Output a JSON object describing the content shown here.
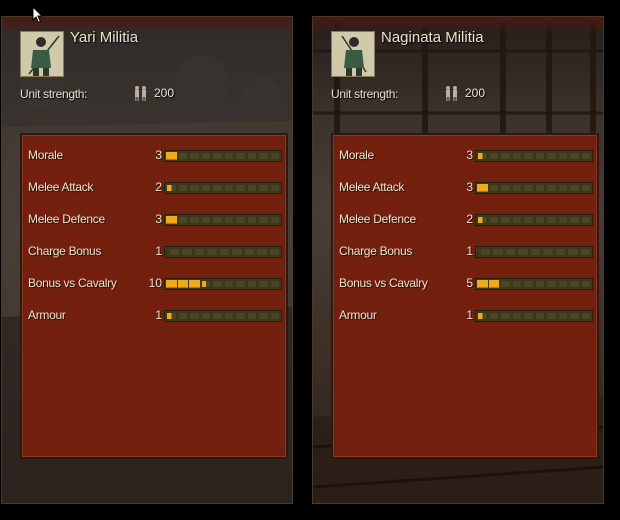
{
  "cursor": "arrow-cursor",
  "colors": {
    "panel": "#73200f",
    "bar_on": "#f3a91c",
    "bar_off": "#4a4626"
  },
  "units": [
    {
      "name": "Yari Militia",
      "strength_label": "Unit strength:",
      "strength_value": "200",
      "stats": [
        {
          "label": "Morale",
          "value": "3",
          "fill": 1
        },
        {
          "label": "Melee Attack",
          "value": "2",
          "fill": 0.5
        },
        {
          "label": "Melee Defence",
          "value": "3",
          "fill": 1
        },
        {
          "label": "Charge Bonus",
          "value": "1",
          "fill": 0.2
        },
        {
          "label": "Bonus vs Cavalry",
          "value": "10",
          "fill": 3.5
        },
        {
          "label": "Armour",
          "value": "1",
          "fill": 0.5
        }
      ]
    },
    {
      "name": "Naginata Militia",
      "strength_label": "Unit strength:",
      "strength_value": "200",
      "stats": [
        {
          "label": "Morale",
          "value": "3",
          "fill": 0.5
        },
        {
          "label": "Melee Attack",
          "value": "3",
          "fill": 1
        },
        {
          "label": "Melee Defence",
          "value": "2",
          "fill": 0.5
        },
        {
          "label": "Charge Bonus",
          "value": "1",
          "fill": 0.2
        },
        {
          "label": "Bonus vs Cavalry",
          "value": "5",
          "fill": 2
        },
        {
          "label": "Armour",
          "value": "1",
          "fill": 0.5
        }
      ]
    }
  ]
}
